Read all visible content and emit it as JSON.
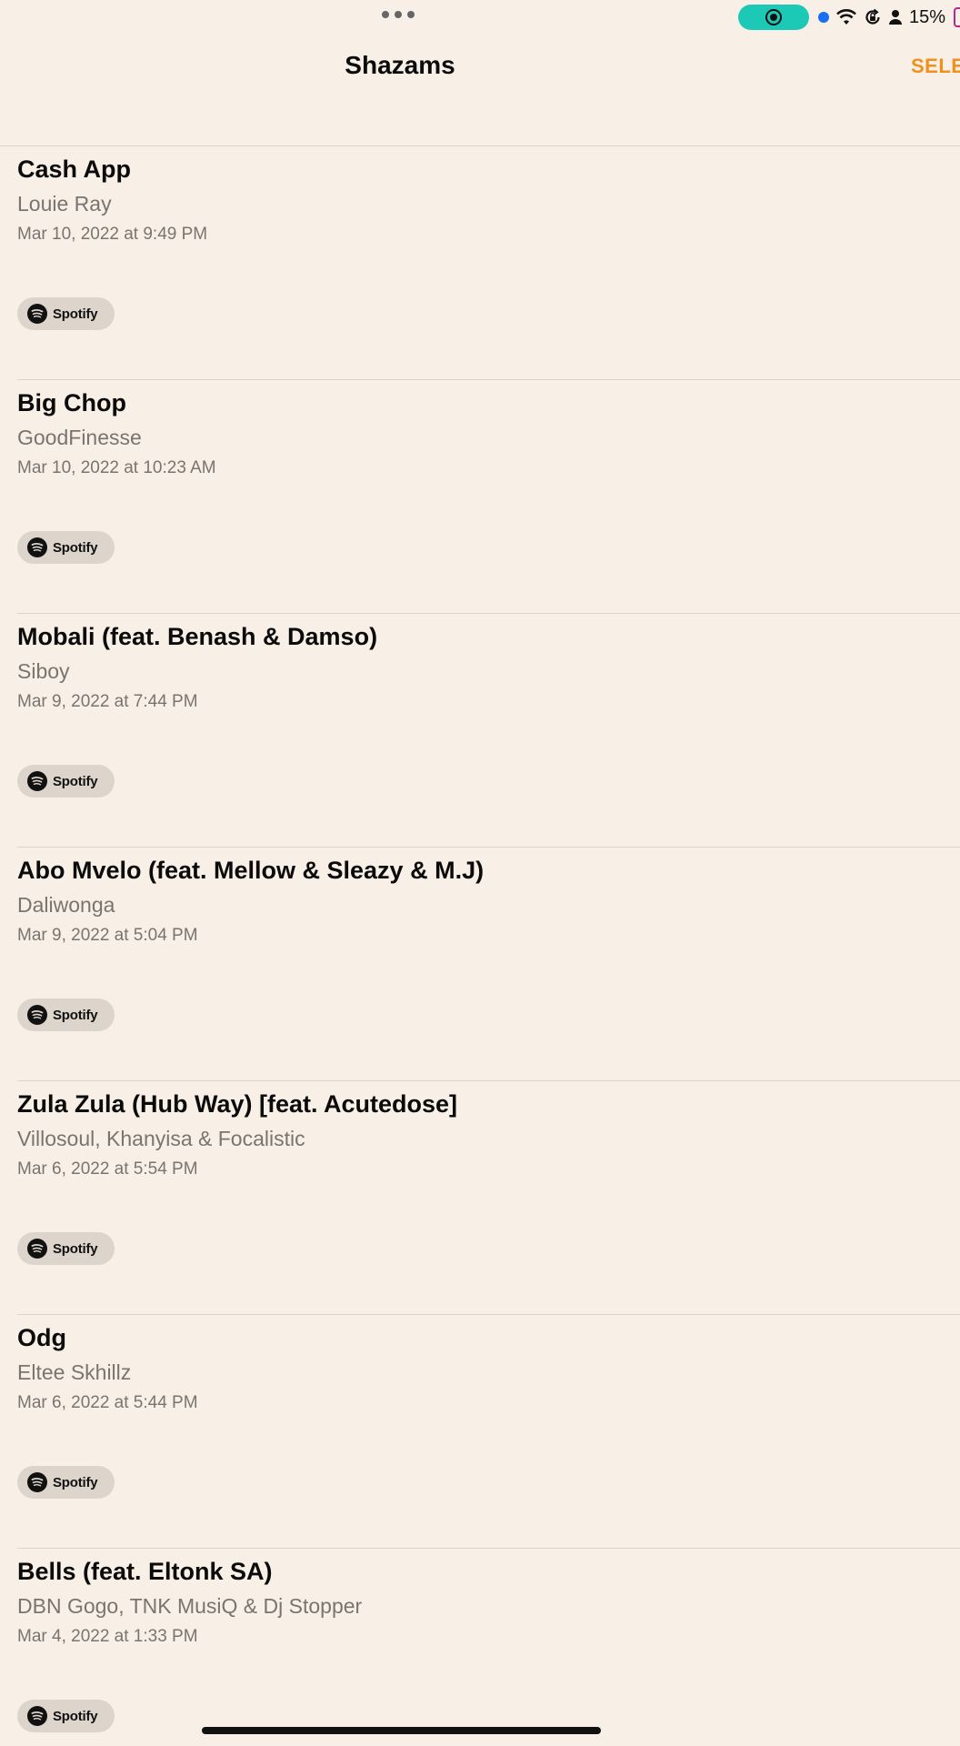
{
  "status_bar": {
    "battery_percent": "15%",
    "icons": [
      "ellipsis-icon",
      "screen-record-icon",
      "camera-indicator-icon",
      "wifi-icon",
      "orientation-lock-icon",
      "person-icon",
      "battery-icon"
    ]
  },
  "nav": {
    "title": "Shazams",
    "select_label": "SELE"
  },
  "colors": {
    "background": "#f8efe6",
    "accent": "#f0901d",
    "record_pill": "#1cc9b6",
    "secondary_text": "#7a7470"
  },
  "songs": [
    {
      "title": "Cash App",
      "artist": "Louie Ray",
      "date": "Mar 10, 2022 at 9:49 PM",
      "service": "Spotify"
    },
    {
      "title": "Big Chop",
      "artist": "GoodFinesse",
      "date": "Mar 10, 2022 at 10:23 AM",
      "service": "Spotify"
    },
    {
      "title": "Mobali (feat. Benash & Damso)",
      "artist": "Siboy",
      "date": "Mar 9, 2022 at 7:44 PM",
      "service": "Spotify"
    },
    {
      "title": "Abo Mvelo (feat. Mellow & Sleazy & M.J)",
      "artist": "Daliwonga",
      "date": "Mar 9, 2022 at 5:04 PM",
      "service": "Spotify"
    },
    {
      "title": "Zula Zula (Hub Way) [feat. Acutedose]",
      "artist": "Villosoul, Khanyisa & Focalistic",
      "date": "Mar 6, 2022 at 5:54 PM",
      "service": "Spotify"
    },
    {
      "title": "Odg",
      "artist": "Eltee Skhillz",
      "date": "Mar 6, 2022 at 5:44 PM",
      "service": "Spotify"
    },
    {
      "title": "Bells (feat. Eltonk SA)",
      "artist": "DBN Gogo, TNK MusiQ & Dj Stopper",
      "date": "Mar 4, 2022 at 1:33 PM",
      "service": "Spotify"
    }
  ]
}
